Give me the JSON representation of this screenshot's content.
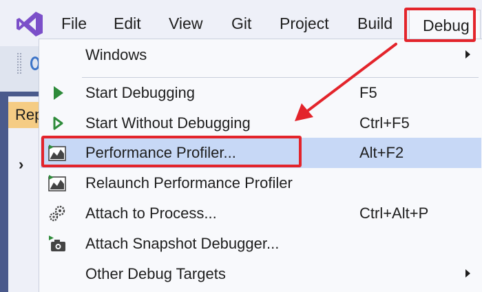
{
  "menubar": {
    "items": [
      {
        "label": "File"
      },
      {
        "label": "Edit"
      },
      {
        "label": "View"
      },
      {
        "label": "Git"
      },
      {
        "label": "Project"
      },
      {
        "label": "Build"
      }
    ],
    "debug_label": "Debug"
  },
  "side": {
    "tab_label": "Rep"
  },
  "debug_menu": {
    "windows": {
      "label": "Windows"
    },
    "start_debugging": {
      "label": "Start Debugging",
      "shortcut": "F5"
    },
    "start_without_debugging": {
      "label": "Start Without Debugging",
      "shortcut": "Ctrl+F5"
    },
    "performance_profiler": {
      "label": "Performance Profiler...",
      "shortcut": "Alt+F2"
    },
    "relaunch_profiler": {
      "label": "Relaunch Performance Profiler"
    },
    "attach_process": {
      "label": "Attach to Process...",
      "shortcut": "Ctrl+Alt+P"
    },
    "attach_snapshot": {
      "label": "Attach Snapshot Debugger..."
    },
    "other_targets": {
      "label": "Other Debug Targets"
    }
  },
  "colors": {
    "highlight": "#e3242b",
    "selected_row": "#c7d8f6",
    "play_green": "#2e8b3a",
    "vs_purple": "#7b4fc9"
  },
  "icons": {
    "app_logo": "visual-studio-logo-icon",
    "start": "play-icon",
    "start_no_debug": "play-outline-icon",
    "profiler": "performance-profiler-icon",
    "attach": "gears-icon",
    "snapshot": "camera-icon",
    "submenu": "chevron-right-icon"
  }
}
